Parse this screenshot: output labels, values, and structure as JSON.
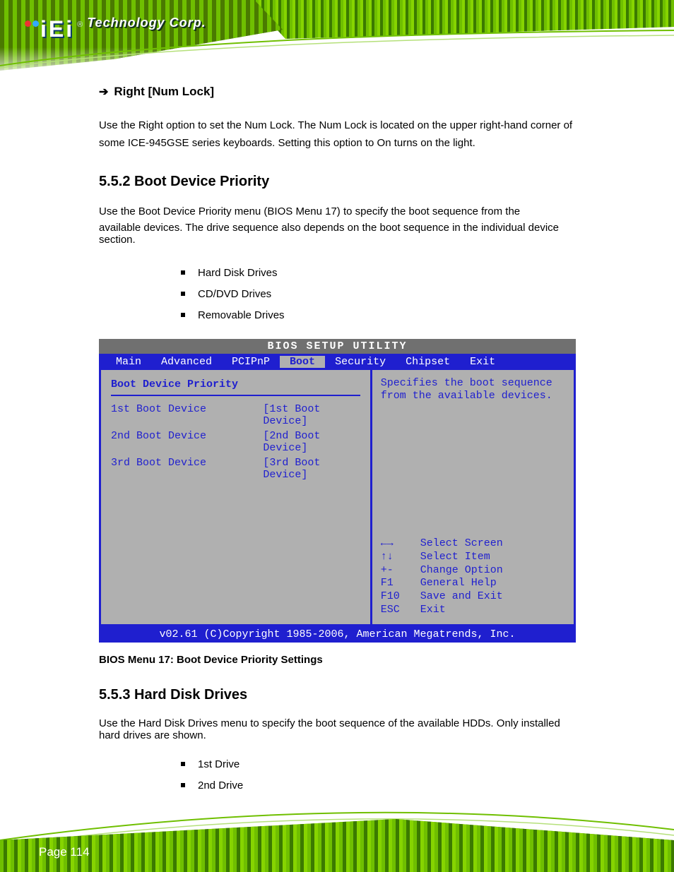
{
  "header": {
    "logo_letters": "iEi",
    "logo_rtm": "®",
    "logo_tagline": "Technology Corp."
  },
  "section_right": {
    "arrow": "➔",
    "heading": "Right [Num Lock]",
    "body": "Use the Right option to set the Num Lock. The Num Lock is located on the upper right-hand corner of some ICE-945GSE series keyboards. Setting this option to On turns on the light."
  },
  "section_main": {
    "title": "5.5.2 Boot Device Priority",
    "line1": "Use the Boot Device Priority menu (BIOS Menu 17) to specify the boot sequence from the",
    "line2": "available devices. The drive sequence also depends on the boot sequence in the individual device section.",
    "bullets": [
      "Hard Disk Drives",
      "CD/DVD Drives",
      "Removable Drives"
    ]
  },
  "bios": {
    "title": "BIOS SETUP UTILITY",
    "tabs": [
      "Main",
      "Advanced",
      "PCIPnP",
      "Boot",
      "Security",
      "Chipset",
      "Exit"
    ],
    "active_tab": "Boot",
    "pane_title": "Boot Device Priority",
    "rows": [
      {
        "label": "1st Boot Device",
        "value": "[1st Boot Device]"
      },
      {
        "label": "2nd Boot Device",
        "value": "[2nd Boot Device]"
      },
      {
        "label": "3rd Boot Device",
        "value": "[3rd Boot Device]"
      }
    ],
    "help": "Specifies the boot sequence from the available devices.",
    "keys": [
      {
        "k": "←→",
        "d": "Select Screen"
      },
      {
        "k": "↑↓",
        "d": "Select Item"
      },
      {
        "k": "+-",
        "d": "Change Option"
      },
      {
        "k": "F1",
        "d": "General Help"
      },
      {
        "k": "F10",
        "d": "Save and Exit"
      },
      {
        "k": "ESC",
        "d": "Exit"
      }
    ],
    "footer": "v02.61 (C)Copyright 1985-2006, American Megatrends, Inc."
  },
  "caption": "BIOS Menu 17: Boot Device Priority Settings",
  "sub_section": {
    "title": "5.5.3 Hard Disk Drives",
    "line": "Use the Hard Disk Drives menu to specify the boot sequence of the available HDDs. Only installed hard drives are shown.",
    "bullets": [
      "1st Drive",
      "2nd Drive"
    ]
  },
  "footer": {
    "page_label": "Page 114"
  }
}
